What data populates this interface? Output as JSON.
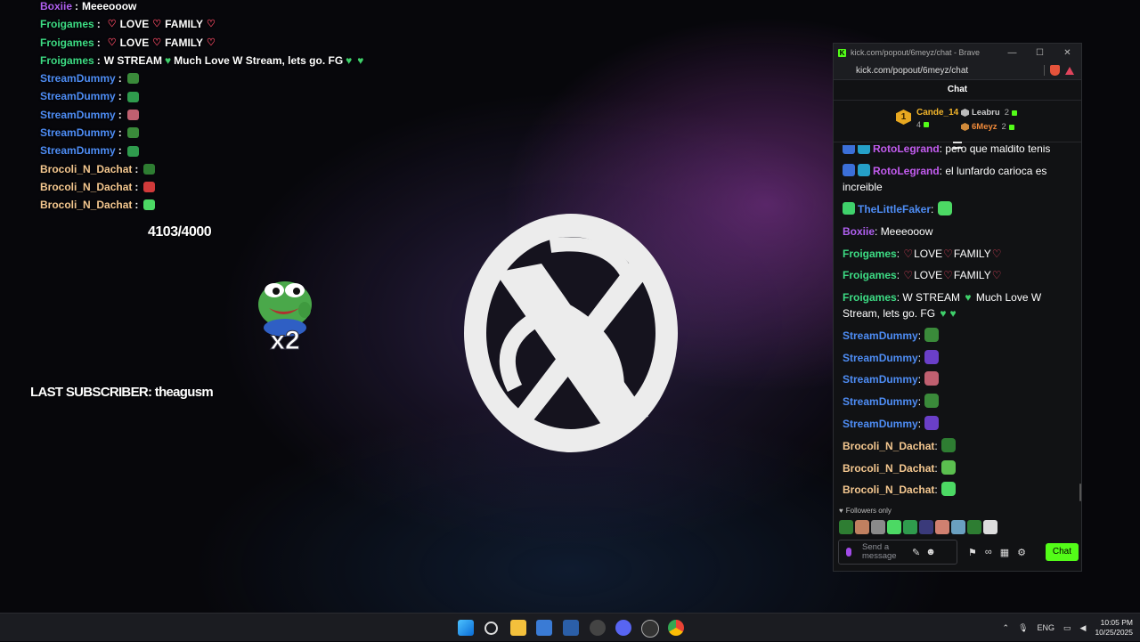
{
  "overlay_chat": [
    {
      "user": "Boxiie",
      "color": "#b060f0",
      "parts": [
        {
          "t": "text",
          "v": "Meeeooow"
        }
      ]
    },
    {
      "user": "Froigames",
      "color": "#3ddc84",
      "parts": [
        {
          "t": "heart"
        },
        {
          "t": "text",
          "v": "LOVE"
        },
        {
          "t": "heart"
        },
        {
          "t": "text",
          "v": "FAMILY"
        },
        {
          "t": "heart"
        }
      ]
    },
    {
      "user": "Froigames",
      "color": "#3ddc84",
      "parts": [
        {
          "t": "heart"
        },
        {
          "t": "text",
          "v": "LOVE"
        },
        {
          "t": "heart"
        },
        {
          "t": "text",
          "v": "FAMILY"
        },
        {
          "t": "heart"
        }
      ]
    },
    {
      "user": "Froigames",
      "color": "#3ddc84",
      "parts": [
        {
          "t": "text",
          "v": "W STREAM"
        },
        {
          "t": "gheart"
        },
        {
          "t": "text",
          "v": "Much Love W Stream, lets go. FG"
        },
        {
          "t": "gheart"
        },
        {
          "t": "gheart"
        }
      ]
    },
    {
      "user": "StreamDummy",
      "color": "#4e8df5",
      "parts": [
        {
          "t": "emote",
          "c": "#3a8a3a"
        }
      ]
    },
    {
      "user": "StreamDummy",
      "color": "#4e8df5",
      "parts": [
        {
          "t": "emote",
          "c": "#2f9b4d"
        }
      ]
    },
    {
      "user": "StreamDummy",
      "color": "#4e8df5",
      "parts": [
        {
          "t": "emote",
          "c": "#c06070"
        }
      ]
    },
    {
      "user": "StreamDummy",
      "color": "#4e8df5",
      "parts": [
        {
          "t": "emote",
          "c": "#3a8a3a"
        }
      ]
    },
    {
      "user": "StreamDummy",
      "color": "#4e8df5",
      "parts": [
        {
          "t": "emote",
          "c": "#2f9b4d"
        }
      ]
    },
    {
      "user": "Brocoli_N_Dachat",
      "color": "#f5c890",
      "parts": [
        {
          "t": "emote",
          "c": "#2e7d32"
        }
      ]
    },
    {
      "user": "Brocoli_N_Dachat",
      "color": "#f5c890",
      "parts": [
        {
          "t": "emote",
          "c": "#d03a3a"
        }
      ]
    },
    {
      "user": "Brocoli_N_Dachat",
      "color": "#f5c890",
      "parts": [
        {
          "t": "emote",
          "c": "#4cd964"
        }
      ]
    }
  ],
  "sub_goal": "4103/4000",
  "sub_multiplier": "x2",
  "last_subscriber": "LAST SUBSCRIBER: theagusm",
  "browser": {
    "title": "kick.com/popout/6meyz/chat - Brave",
    "url": "kick.com/popout/6meyz/chat",
    "min": "—",
    "max": "☐",
    "close": "✕"
  },
  "chat": {
    "header": "Chat",
    "leaderboard": {
      "first": {
        "rank": "1",
        "name": "Cande_14",
        "count": "4"
      },
      "second": {
        "name": "Leabru",
        "count": "2"
      },
      "third": {
        "name": "6Meyz",
        "count": "2"
      }
    },
    "messages": [
      {
        "user": "RotoLegrand",
        "color": "#c35cf0",
        "badges": [
          "#3b6fd8",
          "#25a0c8"
        ],
        "body": "pero que maldito tenis",
        "cut": true
      },
      {
        "user": "RotoLegrand",
        "color": "#c35cf0",
        "badges": [
          "#3b6fd8",
          "#25a0c8"
        ],
        "body": "el lunfardo carioca es increible"
      },
      {
        "user": "TheLittleFaker",
        "color": "#4e8df5",
        "badges": [
          "#3fd16b"
        ],
        "emotes": [
          "#4cd964"
        ]
      },
      {
        "user": "Boxiie",
        "color": "#b060f0",
        "body": "Meeeooow"
      },
      {
        "user": "Froigames",
        "color": "#3ddc84",
        "rich": [
          {
            "t": "heart"
          },
          {
            "t": "text",
            "v": "LOVE"
          },
          {
            "t": "heart"
          },
          {
            "t": "text",
            "v": "FAMILY"
          },
          {
            "t": "heart"
          }
        ]
      },
      {
        "user": "Froigames",
        "color": "#3ddc84",
        "rich": [
          {
            "t": "heart"
          },
          {
            "t": "text",
            "v": "LOVE"
          },
          {
            "t": "heart"
          },
          {
            "t": "text",
            "v": "FAMILY"
          },
          {
            "t": "heart"
          }
        ]
      },
      {
        "user": "Froigames",
        "color": "#3ddc84",
        "rich": [
          {
            "t": "text",
            "v": "W STREAM "
          },
          {
            "t": "gheart"
          },
          {
            "t": "text",
            "v": " Much Love W Stream, lets go. FG "
          },
          {
            "t": "gheart"
          },
          {
            "t": "gheart"
          }
        ]
      },
      {
        "user": "StreamDummy",
        "color": "#4e8df5",
        "emotes": [
          "#3a8a3a"
        ]
      },
      {
        "user": "StreamDummy",
        "color": "#4e8df5",
        "emotes": [
          "#6a3fc8"
        ]
      },
      {
        "user": "StreamDummy",
        "color": "#4e8df5",
        "emotes": [
          "#c06070"
        ]
      },
      {
        "user": "StreamDummy",
        "color": "#4e8df5",
        "emotes": [
          "#3a8a3a"
        ]
      },
      {
        "user": "StreamDummy",
        "color": "#4e8df5",
        "emotes": [
          "#6a3fc8"
        ]
      },
      {
        "user": "Brocoli_N_Dachat",
        "color": "#f5c890",
        "emotes": [
          "#2e7d32"
        ]
      },
      {
        "user": "Brocoli_N_Dachat",
        "color": "#f5c890",
        "emotes": [
          "#5bbf4f"
        ]
      },
      {
        "user": "Brocoli_N_Dachat",
        "color": "#f5c890",
        "emotes": [
          "#4cd964"
        ]
      }
    ],
    "followers_only": "Followers only",
    "emote_bar": [
      "#2e7d32",
      "#c08060",
      "#8a8a8a",
      "#4cd964",
      "#2f9b4d",
      "#3a3a7a",
      "#d08070",
      "#6aa0c0",
      "#2e7d32",
      "#ddd"
    ],
    "composer_placeholder": "Send a message",
    "send_label": "Chat"
  },
  "taskbar": {
    "lang": "ENG",
    "time": "10:05 PM",
    "date": "10/25/2025"
  },
  "colors": {
    "kick_green": "#53fc18",
    "accent_purple": "#a24be8"
  }
}
